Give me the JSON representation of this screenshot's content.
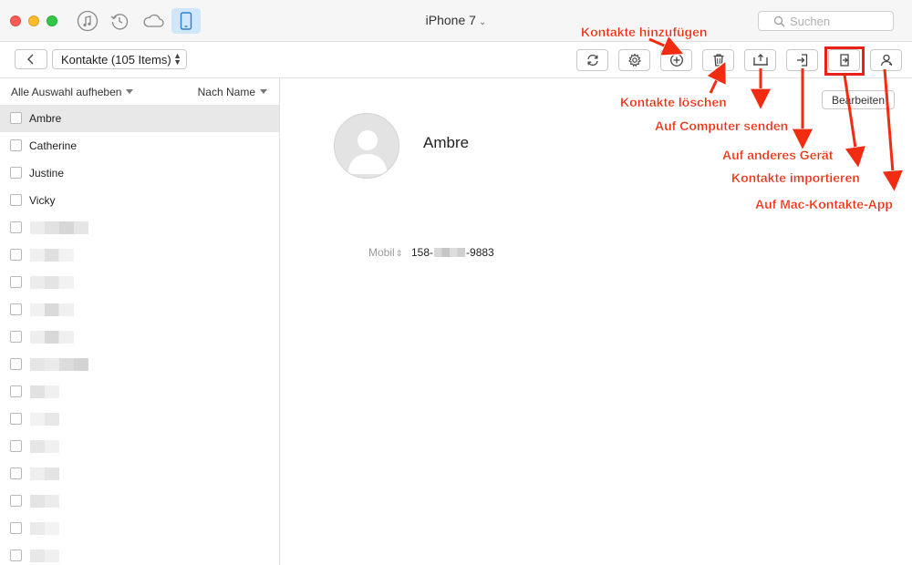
{
  "titlebar": {
    "device_title": "iPhone 7",
    "search_placeholder": "Suchen"
  },
  "toolbar": {
    "category_label": "Kontakte (105 Items)",
    "tools": [
      {
        "name": "refresh",
        "icon": "refresh-icon"
      },
      {
        "name": "settings",
        "icon": "gear-icon"
      },
      {
        "name": "add-contact",
        "icon": "plus-circle-icon"
      },
      {
        "name": "delete-contact",
        "icon": "trash-icon"
      },
      {
        "name": "send-to-computer",
        "icon": "export-computer-icon"
      },
      {
        "name": "send-to-device",
        "icon": "import-device-icon"
      },
      {
        "name": "import-contacts",
        "icon": "import-file-icon"
      },
      {
        "name": "to-mac-contacts",
        "icon": "person-icon"
      }
    ]
  },
  "sidebar": {
    "deselect_label": "Alle Auswahl aufheben",
    "sort_label": "Nach Name",
    "contacts": [
      "Ambre",
      "Catherine",
      "Justine",
      "Vicky"
    ],
    "selected": "Ambre"
  },
  "detail": {
    "name": "Ambre",
    "edit_label": "Bearbeiten",
    "phone_label": "Mobil",
    "phone_prefix": "158-",
    "phone_suffix": "-9883"
  },
  "annotations": {
    "add": "Kontakte hinzufügen",
    "delete": "Kontakte löschen",
    "computer": "Auf Computer senden",
    "device": "Auf anderes Gerät",
    "import": "Kontakte importieren",
    "mac": "Auf Mac-Kontakte-App"
  },
  "colors": {
    "annotation": "#f22c10",
    "selected_row": "#e8e8e8",
    "active_tab": "#cfe6fb"
  }
}
